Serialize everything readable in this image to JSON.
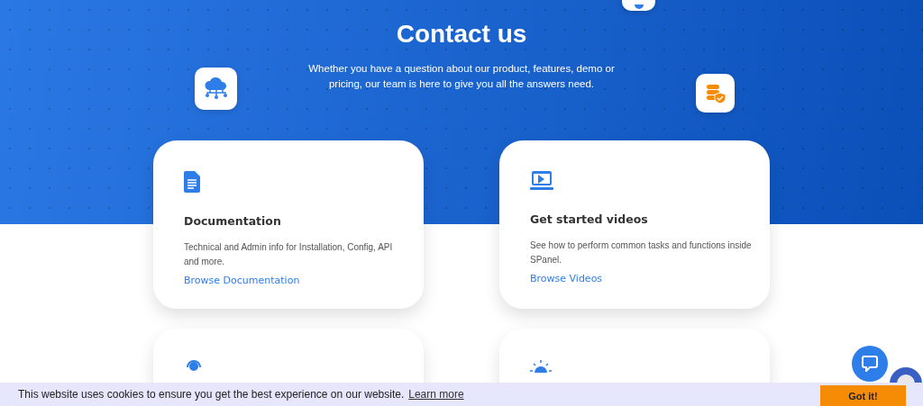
{
  "hero": {
    "title": "Contact us",
    "subtitle": "Whether you have a question about our product, features, demo or pricing, our team is here to give you all the answers need."
  },
  "cards": [
    {
      "kind": "document",
      "title": "Documentation",
      "text": "Technical and Admin info for Installation, Config, API and more.",
      "link": "Browse Documentation"
    },
    {
      "kind": "video",
      "title": "Get started videos",
      "text": "See how to perform common tasks and functions inside SPanel.",
      "link": "Browse Videos"
    },
    {
      "kind": "support"
    },
    {
      "kind": "idea"
    }
  ],
  "cookie_bar": {
    "text": "This website uses cookies to ensure you get the best experience on our website.",
    "link": "Learn more",
    "button": "Got it!"
  }
}
